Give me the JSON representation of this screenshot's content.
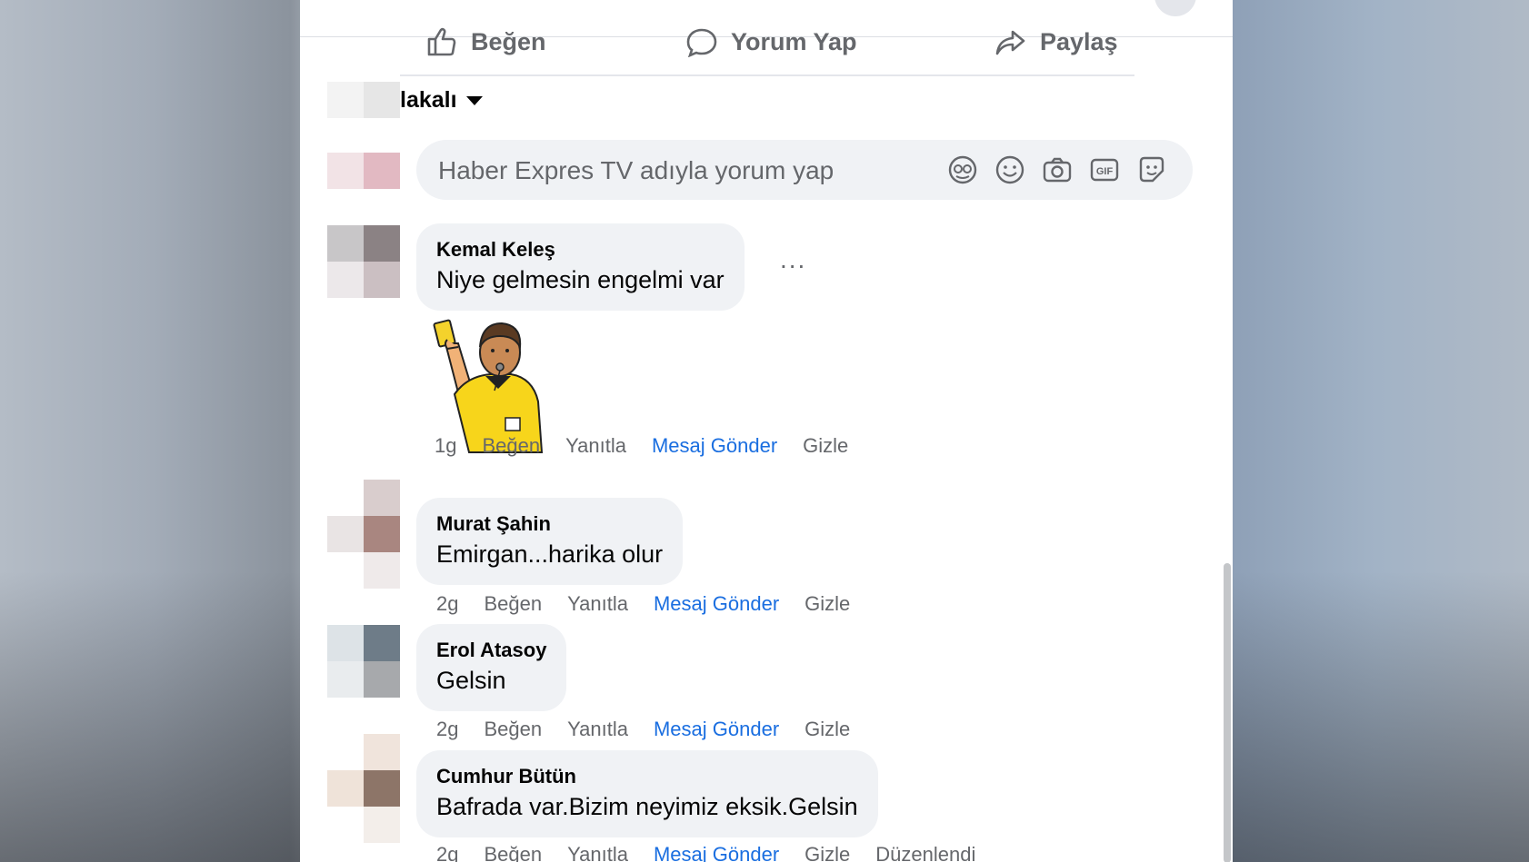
{
  "post_actions": {
    "like": "Beğen",
    "comment": "Yorum Yap",
    "share": "Paylaş"
  },
  "filter": {
    "label": "lakalı"
  },
  "composer": {
    "placeholder": "Haber Expres TV adıyla yorum yap",
    "icons": [
      "avatar-icon",
      "emoji-icon",
      "camera-icon",
      "gif-icon",
      "sticker-icon"
    ]
  },
  "comments": [
    {
      "author": "Kemal Keleş",
      "text": "Niye gelmesin engelmi var",
      "more": "...",
      "sticker": "referee-yellow-card-sticker",
      "time": "1g",
      "like": "Beğen",
      "reply": "Yanıtla",
      "message": "Mesaj Gönder",
      "hide": "Gizle"
    },
    {
      "author": "Murat Şahin",
      "text": "Emirgan...harika olur",
      "time": "2g",
      "like": "Beğen",
      "reply": "Yanıtla",
      "message": "Mesaj Gönder",
      "hide": "Gizle"
    },
    {
      "author": "Erol Atasoy",
      "text": "Gelsin",
      "time": "2g",
      "like": "Beğen",
      "reply": "Yanıtla",
      "message": "Mesaj Gönder",
      "hide": "Gizle"
    },
    {
      "author": "Cumhur Bütün",
      "text": "Bafrada var.Bizim neyimiz eksik.Gelsin",
      "time": "2g",
      "like": "Beğen",
      "reply": "Yanıtla",
      "message": "Mesaj Gönder",
      "hide": "Gizle",
      "edited": "Düzenlendi"
    }
  ],
  "colors": {
    "link": "#1a6ee0",
    "muted": "#65676b",
    "bubble": "#f0f2f5"
  }
}
